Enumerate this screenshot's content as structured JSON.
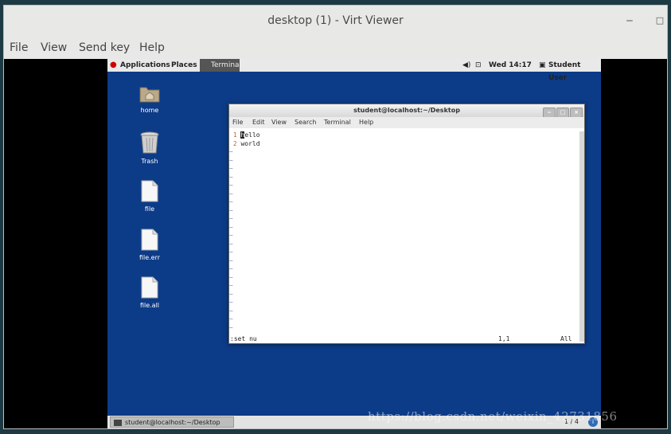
{
  "window": {
    "title": "desktop (1) - Virt Viewer",
    "minimize": "‒",
    "maximize": "□"
  },
  "menu": {
    "file": "File",
    "view": "View",
    "sendkey": "Send key",
    "help": "Help"
  },
  "panel": {
    "applications": "Applications",
    "places": "Places",
    "terminal": "Terminal",
    "volume_icon": "volume-icon",
    "network_icon": "network-icon",
    "clock": "Wed 14:17",
    "user": "Student User"
  },
  "desktop_icons": [
    {
      "label": "home"
    },
    {
      "label": "Trash"
    },
    {
      "label": "file"
    },
    {
      "label": "file.err"
    },
    {
      "label": "file.all"
    }
  ],
  "terminal": {
    "title": "student@localhost:~/Desktop",
    "menu": {
      "file": "File",
      "edit": "Edit",
      "view": "View",
      "search": "Search",
      "terminal": "Terminal",
      "help": "Help"
    },
    "lines": [
      {
        "num": "1",
        "first": "h",
        "rest": "ello"
      },
      {
        "num": "2",
        "text": "world"
      }
    ],
    "tilde": "~",
    "status": {
      "command": ":set nu",
      "position": "1,1",
      "scroll": "All"
    }
  },
  "taskbar": {
    "item": "student@localhost:~/Desktop",
    "pager": "1 / 4"
  },
  "watermark": "https://blog.csdn.net/weixin_42731856"
}
